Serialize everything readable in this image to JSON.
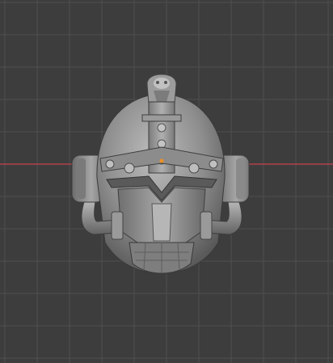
{
  "viewport": {
    "background_color": "#3d3d3d",
    "grid_line_color": "#4f4f4f",
    "x_axis_color": "#c8424e",
    "show_grid": true,
    "show_x_axis": true
  },
  "object": {
    "subject": "helmet-mesh",
    "clay_color": "#8f8f8f",
    "clay_highlight": "#bcbcbc",
    "clay_shadow": "#4a4a4a",
    "origin_color": "#e8912a",
    "selected_origin_visible": true
  }
}
